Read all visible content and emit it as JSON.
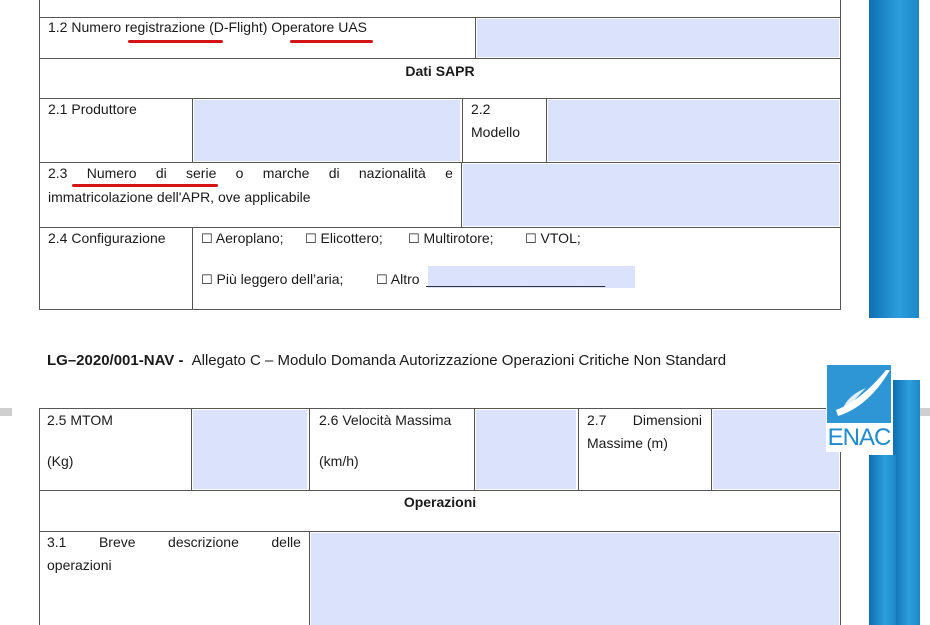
{
  "rows": {
    "r12_label": "1.2 Numero registrazione (D-Flight) Operatore UAS",
    "dati_sapr": "Dati SAPR",
    "r21_label": "2.1 Produttore",
    "r22_num": "2.2",
    "r22_label": "Modello",
    "r23_line1": [
      "2.3",
      "Numero",
      "di",
      "serie",
      "o",
      "marche",
      "di",
      "nazionalità",
      "e"
    ],
    "r23_line2": "immatricolazione dell'APR, ove applicabile",
    "r24_label": "2.4 Configurazione",
    "options": [
      "Aeroplano;",
      "Elicottero;",
      "Multirotore;",
      "VTOL;",
      "Più leggero dell’aria;",
      "Altro"
    ],
    "altro_line": "_______________________",
    "r25_label": "2.5 MTOM",
    "r25_unit": "(Kg)",
    "r26_label": "2.6 Velocità Massima",
    "r26_unit": "(km/h)",
    "r27_line1": [
      "2.7",
      "Dimensioni"
    ],
    "r27_line2": "Massime  (m)",
    "operazioni": "Operazioni",
    "r31_line1": [
      "3.1",
      "Breve",
      "descrizione",
      "delle"
    ],
    "r31_line2": "operazioni"
  },
  "header": {
    "code": "LG–2020/001-NAV -",
    "title": "Allegato C – Modulo Domanda Autorizzazione Operazioni Critiche Non Standard"
  },
  "logo": {
    "text": "ENAC",
    "color": "#1f8bd0"
  },
  "checkbox_glyph": "☐"
}
